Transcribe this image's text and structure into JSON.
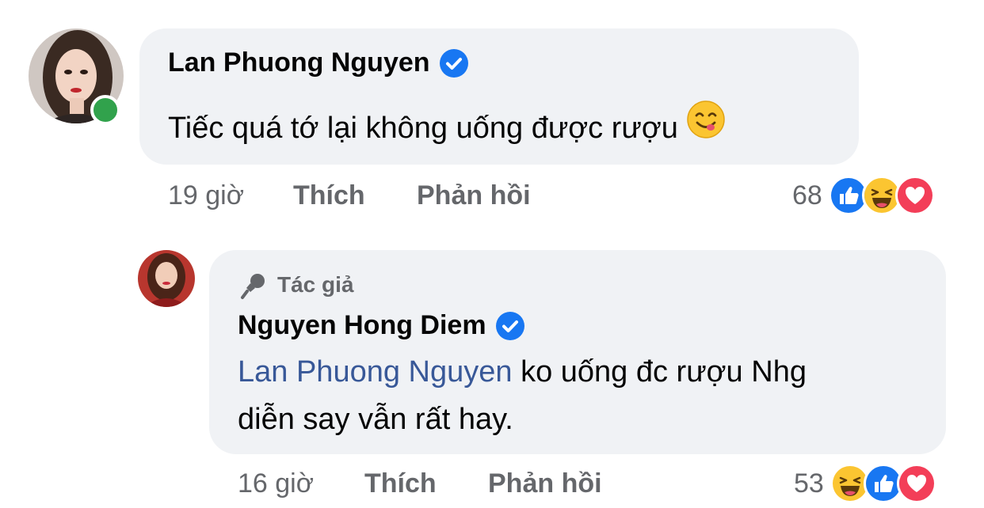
{
  "comments": [
    {
      "author": "Lan Phuong Nguyen",
      "verified": true,
      "online": true,
      "text": "Tiếc quá tớ lại không uống được rượu",
      "emoji": "yum-face-emoji",
      "time": "19 giờ",
      "like_label": "Thích",
      "reply_label": "Phản hồi",
      "reaction_count": "68",
      "reactions": [
        "like",
        "haha",
        "love"
      ]
    }
  ],
  "reply": {
    "badge": "Tác giả",
    "badge_icon": "microphone-icon",
    "author": "Nguyen Hong Diem",
    "verified": true,
    "mention": "Lan Phuong Nguyen",
    "text_line1": " ko uống đc rượu Nhg",
    "text_line2": "diễn say vẫn rất hay.",
    "time": "16 giờ",
    "like_label": "Thích",
    "reply_label": "Phản hồi",
    "reaction_count": "53",
    "reactions": [
      "haha",
      "like",
      "love"
    ]
  },
  "colors": {
    "bubble": "#f0f2f5",
    "verified": "#1877f2",
    "online": "#31a24c",
    "mention": "#385898",
    "meta": "#65676b"
  }
}
